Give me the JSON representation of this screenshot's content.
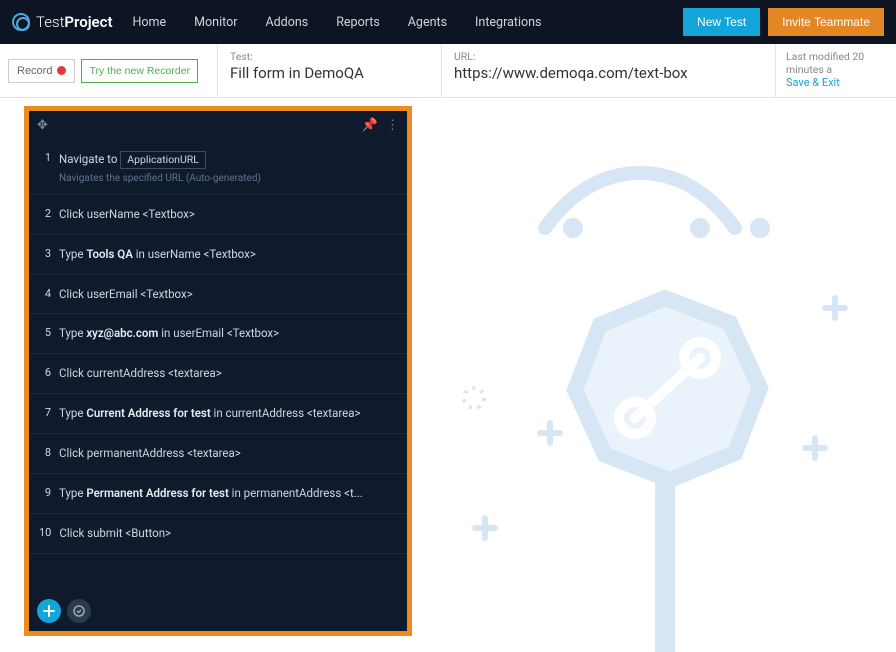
{
  "logo": {
    "text1": "Test",
    "text2": "Project"
  },
  "nav": [
    "Home",
    "Monitor",
    "Addons",
    "Reports",
    "Agents",
    "Integrations"
  ],
  "buttons": {
    "newTest": "New Test",
    "invite": "Invite Teammate"
  },
  "toolbar": {
    "record": "Record",
    "tryRecorder": "Try the new Recorder"
  },
  "testBlock": {
    "label": "Test:",
    "value": "Fill form in DemoQA"
  },
  "urlBlock": {
    "label": "URL:",
    "value": "https://www.demoqa.com/text-box"
  },
  "modified": {
    "text": "Last modified 20 minutes a",
    "link": "Save & Exit"
  },
  "step1": {
    "num": "1",
    "pre": "Navigate to",
    "chip": "ApplicationURL",
    "sub": "Navigates the specified URL (Auto-generated)"
  },
  "steps": [
    {
      "num": "2",
      "html": "Click userName <Textbox>"
    },
    {
      "num": "3",
      "html": "Type <b>Tools QA</b> in userName <Textbox>"
    },
    {
      "num": "4",
      "html": "Click userEmail <Textbox>"
    },
    {
      "num": "5",
      "html": "Type <b>xyz@abc.com</b> in userEmail <Textbox>"
    },
    {
      "num": "6",
      "html": "Click currentAddress <textarea>"
    },
    {
      "num": "7",
      "html": "Type <b>Current Address for test</b> in currentAddress <textarea>"
    },
    {
      "num": "8",
      "html": "Click permanentAddress <textarea>"
    },
    {
      "num": "9",
      "html": "Type <b>Permanent Address for test</b> in permanentAddress <t..."
    },
    {
      "num": "10",
      "html": "Click submit <Button>"
    }
  ]
}
